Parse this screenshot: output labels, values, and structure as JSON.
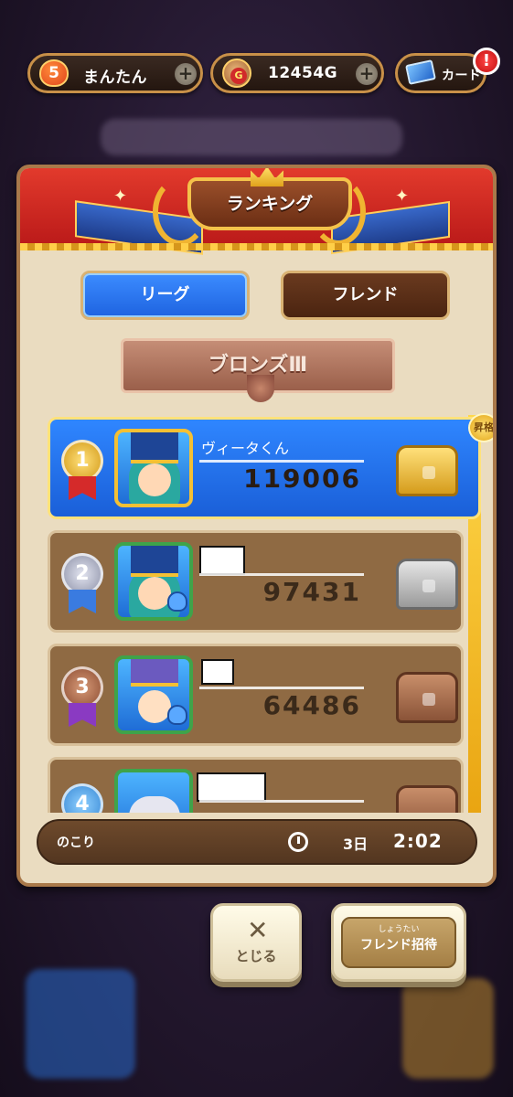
{
  "status_bar": {
    "level": "5",
    "stamina": "まんたん",
    "gold": "12454G",
    "card": "カード",
    "alert": "!"
  },
  "panel": {
    "title": "ランキング",
    "tabs": [
      {
        "label": "リーグ",
        "active": true
      },
      {
        "label": "フレンド",
        "active": false
      }
    ],
    "league": "ブロンズⅢ",
    "promotion_badge": "昇格"
  },
  "ranking": [
    {
      "rank": "1",
      "name": "ヴィータくん",
      "score": "119006",
      "chest": "gold-chest-icon"
    },
    {
      "rank": "2",
      "name": "",
      "score": "97431",
      "chest": "silver-chest-icon"
    },
    {
      "rank": "3",
      "name": "",
      "score": "64486",
      "chest": "bronze-chest-icon"
    },
    {
      "rank": "4",
      "name": "",
      "score": "",
      "chest": "bronze-chest-icon"
    }
  ],
  "footer": {
    "remaining_label": "のこり",
    "days": "3日",
    "time": "2:02"
  },
  "buttons": {
    "close": "とじる",
    "invite_ruby": "しょうたい",
    "invite": "フレンド招待"
  },
  "colors": {
    "league_tab": "#1e63e0",
    "first_row": "#2f86ff",
    "other_row": "#8f6a43",
    "gold_rail": "#ffd84a"
  }
}
